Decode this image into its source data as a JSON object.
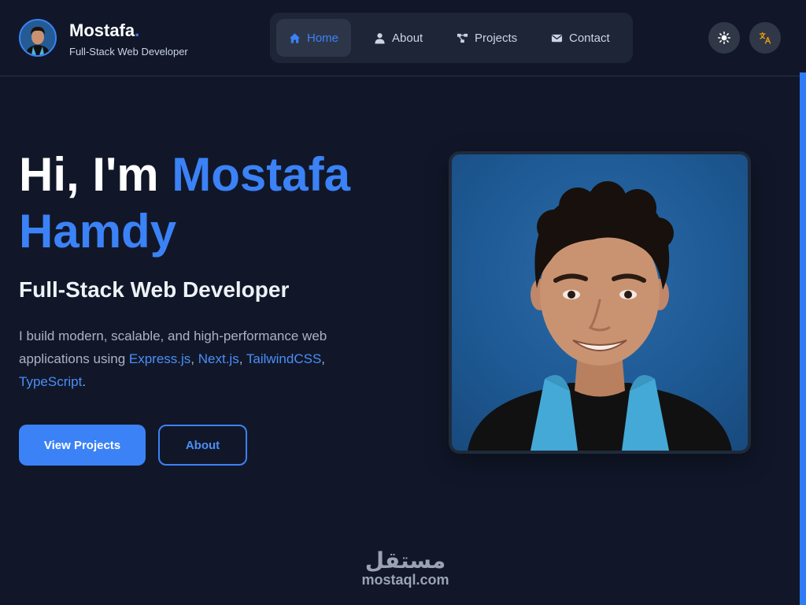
{
  "brand": {
    "name": "Mostafa",
    "dot": ".",
    "subtitle": "Full-Stack Web Developer"
  },
  "nav": {
    "items": [
      {
        "label": "Home",
        "icon": "home-icon",
        "active": true
      },
      {
        "label": "About",
        "icon": "user-icon",
        "active": false
      },
      {
        "label": "Projects",
        "icon": "projects-icon",
        "active": false
      },
      {
        "label": "Contact",
        "icon": "envelope-icon",
        "active": false
      }
    ]
  },
  "header_actions": {
    "theme_icon": "sun-icon",
    "language_icon": "translate-icon"
  },
  "hero": {
    "greeting": "Hi, I'm ",
    "name_first": "Mostafa",
    "name_last": "Hamdy",
    "role": "Full-Stack Web Developer",
    "desc_prefix": "I build modern, scalable, and high-performance web applications using ",
    "techs": [
      "Express.js",
      "Next.js",
      "TailwindCSS",
      "TypeScript"
    ],
    "desc_suffix": ".",
    "primary_button": "View Projects",
    "secondary_button": "About"
  },
  "watermark": {
    "arabic": "مستقل",
    "latin": "mostaql.com"
  },
  "colors": {
    "background": "#111729",
    "accent": "#3b82f6",
    "nav_background": "#1d2536",
    "photo_background": "#1e5a95"
  }
}
